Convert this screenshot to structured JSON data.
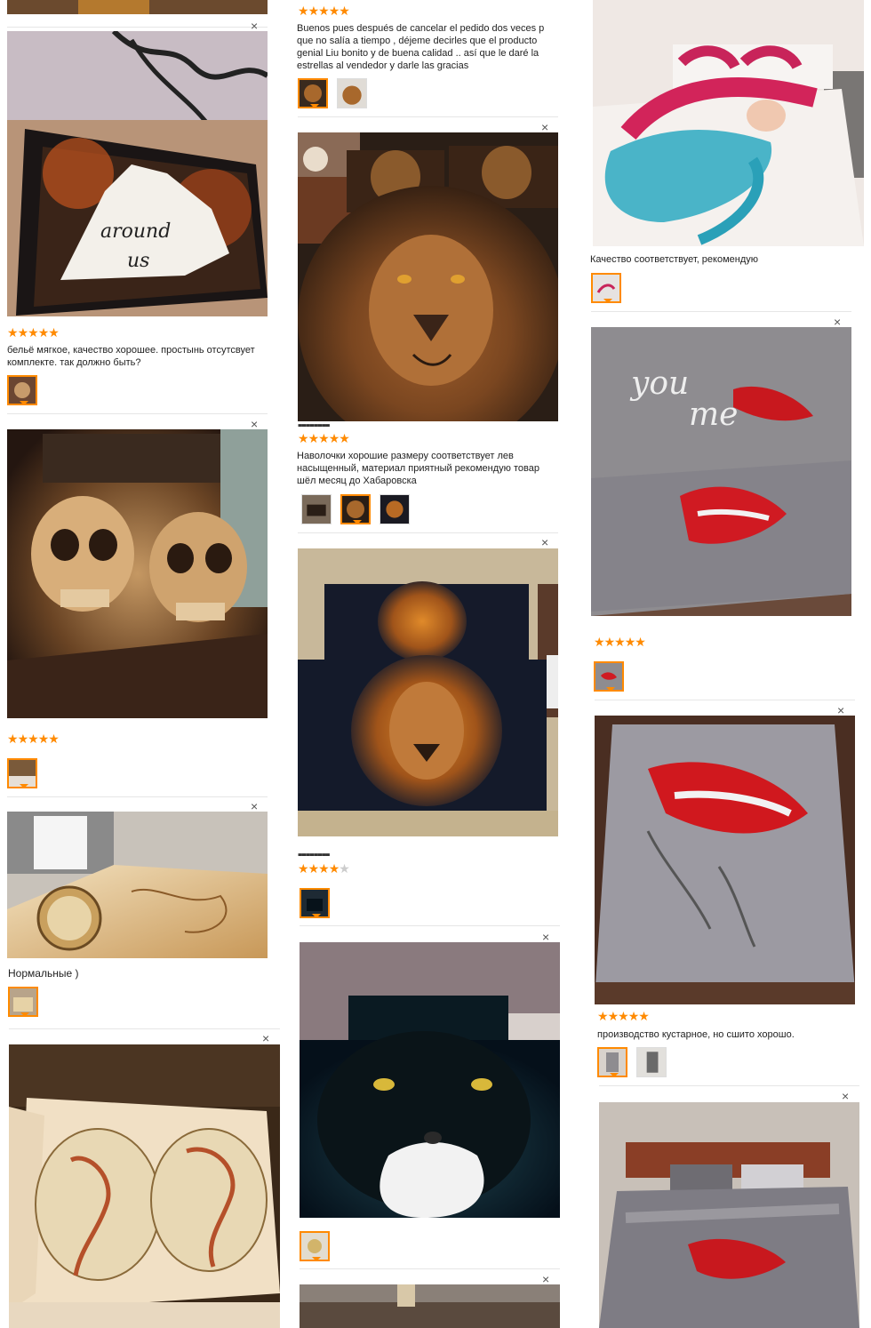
{
  "close_glyph": "×",
  "reviews": [
    {
      "id": "r1",
      "stars": 5,
      "text": "бельё мягкое, качество хорошее. простынь отсутсвует комплекте. так должно быть?"
    },
    {
      "id": "r2",
      "stars": 5,
      "text": ""
    },
    {
      "id": "r3",
      "stars": 0,
      "text": "Нормальные )"
    },
    {
      "id": "r4",
      "stars": 5,
      "text": "Buenos pues después de cancelar el pedido dos veces p\nque no salía a tiempo , déjeme decirles que el producto\ngenial Liu bonito y de buena calidad .. así que le daré la\nestrellas al vendedor y darle las gracias"
    },
    {
      "id": "r5",
      "stars": 5,
      "text": "Наволочки хорошие размеру соответствует лев\nнасыщенный, материал приятный рекомендую товар\nшёл месяц до Хабаровска"
    },
    {
      "id": "r6",
      "stars": 4,
      "text": ""
    },
    {
      "id": "r7",
      "stars": 0,
      "text": "Качество соответствует, рекомендую"
    },
    {
      "id": "r8",
      "stars": 5,
      "text": ""
    },
    {
      "id": "r9",
      "stars": 5,
      "text": "производство кустарное, но сшито хорошо."
    }
  ],
  "photos": {
    "unicorn": "unicorn-bedding-photo",
    "skulls": "skull-bedding-photo",
    "map-bed": "map-bedding-photo",
    "map-pillows": "world-map-pillows-photo",
    "lion-bed": "lion-bedding-photo",
    "lion-pillows": "lion-pillowcases-photo",
    "cat": "cat-bedding-photo",
    "mermaid": "mermaid-bedding-photo",
    "lips1": "lips-duvet-photo",
    "lips2": "lips-bed-photo",
    "youme": "you-and-me-bed-photo"
  },
  "colors": {
    "accent": "#ff8a00",
    "star_off": "#cccccc"
  }
}
